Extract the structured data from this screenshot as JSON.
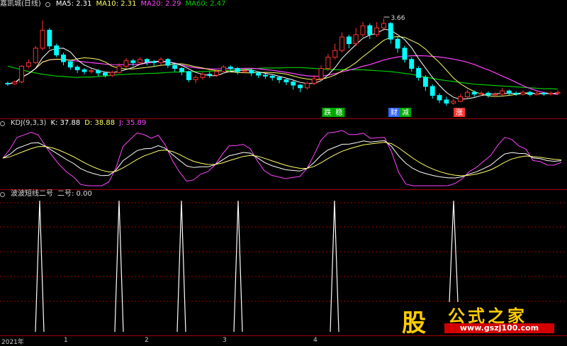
{
  "colors": {
    "up": "#ff3333",
    "down": "#00ffff",
    "ma5": "#ffffff",
    "ma10": "#ffff66",
    "ma20": "#ff44ff",
    "ma60": "#00cc00",
    "grid": "#a00000"
  },
  "main": {
    "title": "嘉凯城(日线)",
    "ma5": "MA5: 2.31",
    "ma10": "MA10: 2.31",
    "ma20": "MA20: 2.29",
    "ma60": "MA60: 2.47",
    "peak_label": "3.66",
    "tags": [
      {
        "text": "跌",
        "color": "#00aa00"
      },
      {
        "text": "稳",
        "color": "#00aa00"
      },
      {
        "text": "财",
        "color": "#3366ff"
      },
      {
        "text": "减",
        "color": "#00aa00"
      },
      {
        "text": "涨",
        "color": "#ff3333"
      }
    ]
  },
  "kdj": {
    "title": "KDJ(9,3,3)",
    "k": "K: 37.88",
    "d": "D: 38.88",
    "j": "J: 35.89"
  },
  "sub": {
    "title": "波波短线二号",
    "value": "二号: 0.00"
  },
  "axis": {
    "labels": [
      "2021年",
      "1",
      "2",
      "3",
      "4"
    ]
  },
  "logo": {
    "char": "股",
    "title": "公式之家",
    "url": "www.gszj100.com"
  },
  "chart_data": {
    "type": "candlestick",
    "ylim": [
      1.55,
      3.85
    ],
    "candles": [
      [
        2.22,
        2.21,
        2.16,
        2.26
      ],
      [
        2.21,
        2.25,
        2.18,
        2.28
      ],
      [
        2.25,
        2.6,
        2.22,
        2.62
      ],
      [
        2.6,
        2.68,
        2.55,
        2.75
      ],
      [
        2.68,
        3.0,
        2.65,
        3.05
      ],
      [
        3.0,
        3.4,
        2.95,
        3.62
      ],
      [
        3.4,
        3.05,
        2.98,
        3.45
      ],
      [
        3.05,
        2.85,
        2.8,
        3.1
      ],
      [
        2.85,
        2.7,
        2.62,
        2.9
      ],
      [
        2.7,
        2.58,
        2.52,
        2.74
      ],
      [
        2.58,
        2.52,
        2.45,
        2.62
      ],
      [
        2.52,
        2.48,
        2.42,
        2.56
      ],
      [
        2.48,
        2.5,
        2.44,
        2.55
      ],
      [
        2.5,
        2.45,
        2.38,
        2.54
      ],
      [
        2.45,
        2.4,
        2.35,
        2.48
      ],
      [
        2.4,
        2.46,
        2.36,
        2.5
      ],
      [
        2.46,
        2.6,
        2.44,
        2.66
      ],
      [
        2.6,
        2.72,
        2.56,
        2.78
      ],
      [
        2.72,
        2.68,
        2.6,
        2.76
      ],
      [
        2.68,
        2.75,
        2.64,
        2.8
      ],
      [
        2.75,
        2.7,
        2.62,
        2.78
      ],
      [
        2.7,
        2.68,
        2.6,
        2.74
      ],
      [
        2.68,
        2.75,
        2.63,
        2.8
      ],
      [
        2.75,
        2.62,
        2.56,
        2.78
      ],
      [
        2.62,
        2.55,
        2.48,
        2.66
      ],
      [
        2.55,
        2.48,
        2.4,
        2.58
      ],
      [
        2.48,
        2.3,
        2.25,
        2.5
      ],
      [
        2.3,
        2.35,
        2.22,
        2.4
      ],
      [
        2.35,
        2.42,
        2.3,
        2.46
      ],
      [
        2.42,
        2.4,
        2.34,
        2.48
      ],
      [
        2.4,
        2.48,
        2.36,
        2.52
      ],
      [
        2.48,
        2.58,
        2.44,
        2.62
      ],
      [
        2.58,
        2.55,
        2.5,
        2.62
      ],
      [
        2.55,
        2.48,
        2.42,
        2.58
      ],
      [
        2.48,
        2.5,
        2.44,
        2.54
      ],
      [
        2.5,
        2.45,
        2.38,
        2.54
      ],
      [
        2.45,
        2.4,
        2.34,
        2.48
      ],
      [
        2.4,
        2.38,
        2.32,
        2.44
      ],
      [
        2.38,
        2.35,
        2.28,
        2.4
      ],
      [
        2.35,
        2.3,
        2.22,
        2.38
      ],
      [
        2.3,
        2.25,
        2.18,
        2.32
      ],
      [
        2.25,
        2.18,
        2.08,
        2.28
      ],
      [
        2.18,
        2.12,
        2.02,
        2.2
      ],
      [
        2.12,
        2.22,
        2.08,
        2.26
      ],
      [
        2.22,
        2.32,
        2.18,
        2.4
      ],
      [
        2.32,
        2.55,
        2.28,
        2.62
      ],
      [
        2.55,
        2.8,
        2.5,
        2.88
      ],
      [
        2.8,
        2.95,
        2.75,
        3.1
      ],
      [
        2.95,
        3.25,
        2.9,
        3.35
      ],
      [
        3.25,
        3.1,
        3.0,
        3.3
      ],
      [
        3.1,
        3.3,
        3.05,
        3.45
      ],
      [
        3.3,
        3.5,
        3.25,
        3.58
      ],
      [
        3.5,
        3.3,
        3.2,
        3.55
      ],
      [
        3.3,
        3.45,
        3.25,
        3.58
      ],
      [
        3.45,
        3.55,
        3.38,
        3.66
      ],
      [
        3.55,
        3.2,
        3.1,
        3.58
      ],
      [
        3.2,
        3.0,
        2.9,
        3.25
      ],
      [
        3.0,
        2.75,
        2.68,
        3.05
      ],
      [
        2.75,
        2.55,
        2.48,
        2.8
      ],
      [
        2.55,
        2.35,
        2.28,
        2.6
      ],
      [
        2.35,
        2.15,
        2.05,
        2.4
      ],
      [
        2.15,
        1.95,
        1.88,
        2.2
      ],
      [
        1.95,
        1.85,
        1.78,
        2.0
      ],
      [
        1.85,
        1.78,
        1.72,
        1.92
      ],
      [
        1.78,
        1.82,
        1.74,
        1.88
      ],
      [
        1.82,
        1.92,
        1.8,
        1.98
      ],
      [
        1.92,
        2.02,
        1.88,
        2.08
      ],
      [
        2.02,
        1.98,
        1.92,
        2.06
      ],
      [
        1.98,
        2.0,
        1.94,
        2.04
      ],
      [
        2.0,
        1.96,
        1.9,
        2.04
      ],
      [
        1.96,
        1.98,
        1.92,
        2.02
      ],
      [
        1.98,
        2.05,
        1.95,
        2.12
      ],
      [
        2.05,
        2.0,
        1.94,
        2.08
      ],
      [
        2.0,
        1.98,
        1.94,
        2.04
      ],
      [
        1.98,
        2.02,
        1.95,
        2.06
      ],
      [
        2.02,
        1.97,
        1.93,
        2.05
      ],
      [
        1.97,
        2.0,
        1.95,
        2.04
      ],
      [
        2.0,
        1.98,
        1.94,
        2.03
      ],
      [
        1.98,
        2.0,
        1.95,
        2.04
      ],
      [
        2.0,
        2.02,
        1.96,
        2.06
      ]
    ],
    "ma60": [
      2.6,
      2.56,
      2.52,
      2.48,
      2.45,
      2.42,
      2.4,
      2.38,
      2.37,
      2.36,
      2.35,
      2.36,
      2.36,
      2.37,
      2.38,
      2.4,
      2.41,
      2.42,
      2.43,
      2.43,
      2.44,
      2.44,
      2.45,
      2.46,
      2.47,
      2.47,
      2.48,
      2.48,
      2.48,
      2.49,
      2.49,
      2.5,
      2.51,
      2.52,
      2.53,
      2.54,
      2.55,
      2.56,
      2.56,
      2.56,
      2.57,
      2.57,
      2.57,
      2.56,
      2.55,
      2.54,
      2.53,
      2.52,
      2.52,
      2.52,
      2.52,
      2.52,
      2.51,
      2.5,
      2.49,
      2.48,
      2.46,
      2.44,
      2.42,
      2.39,
      2.36,
      2.33,
      2.3,
      2.28,
      2.26,
      2.24,
      2.22,
      2.2,
      2.19,
      2.18,
      2.17,
      2.16,
      2.15,
      2.14,
      2.13,
      2.12,
      2.11,
      2.1,
      2.1,
      2.09
    ],
    "spike_positions": [
      0.07,
      0.21,
      0.32,
      0.42,
      0.59,
      0.8
    ]
  }
}
